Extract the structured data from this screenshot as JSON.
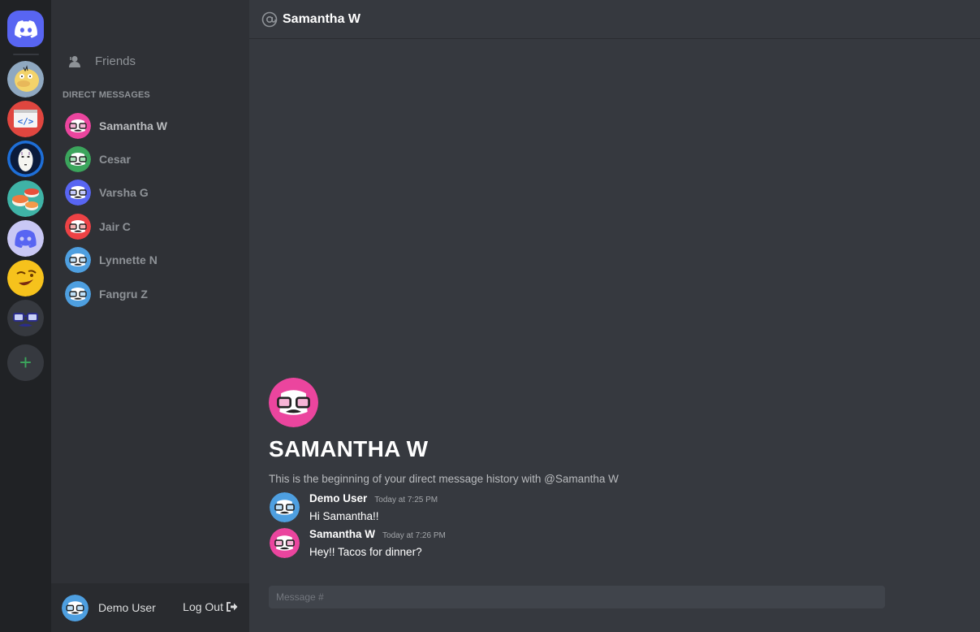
{
  "servers": [
    {
      "name": "home",
      "icon": "discord-logo-icon"
    },
    {
      "name": "server-psyduck",
      "icon": "psyduck-icon"
    },
    {
      "name": "server-code",
      "icon": "code-icon"
    },
    {
      "name": "server-noface",
      "icon": "noface-icon"
    },
    {
      "name": "server-sushi",
      "icon": "sushi-icon"
    },
    {
      "name": "server-clyde",
      "icon": "clyde-icon"
    },
    {
      "name": "server-emoji",
      "icon": "emoji-icon"
    },
    {
      "name": "server-nerd",
      "icon": "nerd-icon"
    },
    {
      "name": "add-server",
      "icon": "plus-icon",
      "label": "+"
    }
  ],
  "sidebar": {
    "friends_label": "Friends",
    "dm_header": "DIRECT MESSAGES",
    "dms": [
      {
        "name": "Samantha W",
        "color": "#eb459e"
      },
      {
        "name": "Cesar",
        "color": "#3ba55c"
      },
      {
        "name": "Varsha G",
        "color": "#5865f2"
      },
      {
        "name": "Jair C",
        "color": "#ed4245"
      },
      {
        "name": "Lynnette N",
        "color": "#4e9fe0"
      },
      {
        "name": "Fangru Z",
        "color": "#4e9fe0"
      }
    ]
  },
  "userbar": {
    "username": "Demo User",
    "avatar_color": "#4e9fe0",
    "logout_label": "Log Out"
  },
  "header": {
    "title": "Samantha W"
  },
  "intro": {
    "name": "SAMANTHA W",
    "avatar_color": "#eb459e",
    "text": "This is the beginning of your direct message history with @Samantha W"
  },
  "messages": [
    {
      "author": "Demo User",
      "time": "Today at 7:25 PM",
      "content": "Hi Samantha!!",
      "color": "#4e9fe0"
    },
    {
      "author": "Samantha W",
      "time": "Today at 7:26 PM",
      "content": "Hey!! Tacos for dinner?",
      "color": "#eb459e"
    }
  ],
  "composer": {
    "placeholder": "Message #"
  },
  "colors": {
    "rail": "#202225",
    "sidebar": "#2f3136",
    "main": "#36393f",
    "blurple": "#5865f2",
    "green": "#3ba55c"
  }
}
